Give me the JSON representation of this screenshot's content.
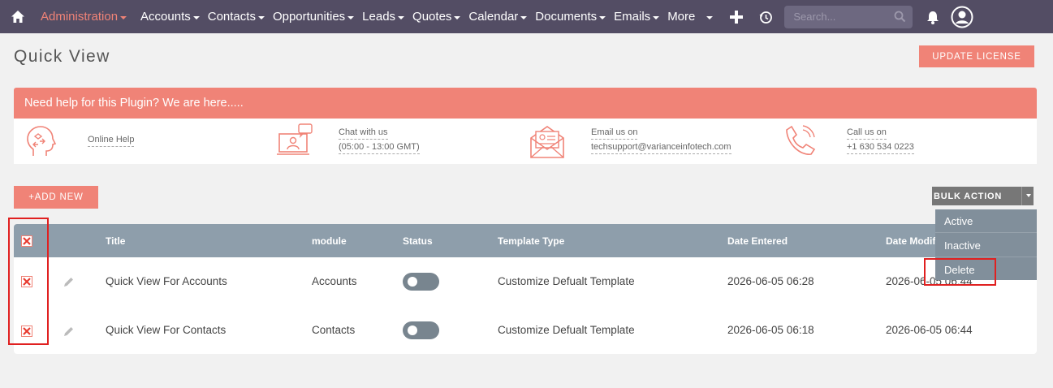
{
  "nav": {
    "items": [
      {
        "label": "Administration",
        "active": true
      },
      {
        "label": "Accounts"
      },
      {
        "label": "Contacts"
      },
      {
        "label": "Opportunities"
      },
      {
        "label": "Leads"
      },
      {
        "label": "Quotes"
      },
      {
        "label": "Calendar"
      },
      {
        "label": "Documents"
      },
      {
        "label": "Emails"
      }
    ],
    "more_label": "More",
    "search_placeholder": "Search..."
  },
  "page": {
    "title": "Quick View",
    "update_license_label": "UPDATE LICENSE"
  },
  "help": {
    "banner_text": "Need help for this Plugin? We are here.....",
    "online_help": "Online Help",
    "chat_line1": "Chat with us",
    "chat_line2": "(05:00 - 13:00 GMT)",
    "email_line1": "Email us on",
    "email_line2": "techsupport@varianceinfotech.com",
    "call_line1": "Call us on",
    "call_line2": "+1 630 534 0223"
  },
  "actions": {
    "add_new_label": "+ADD NEW",
    "bulk_action_label": "BULK ACTION"
  },
  "table": {
    "columns": [
      "Title",
      "module",
      "Status",
      "Template Type",
      "Date Entered",
      "Date Modified"
    ],
    "rows": [
      {
        "title": "Quick View For Accounts",
        "module": "Accounts",
        "status_on": false,
        "template_type": "Customize Defualt Template",
        "date_entered": "2026-06-05 06:28",
        "date_modified": "2026-06-05 06:44"
      },
      {
        "title": "Quick View For Contacts",
        "module": "Contacts",
        "status_on": false,
        "template_type": "Customize Defualt Template",
        "date_entered": "2026-06-05 06:18",
        "date_modified": "2026-06-05 06:44"
      }
    ]
  },
  "bulk_menu": {
    "items": [
      "Active",
      "Inactive",
      "Delete"
    ]
  },
  "colors": {
    "nav_bg": "#534d64",
    "accent": "#f08377",
    "table_header": "#8e9eab",
    "highlight": "#e02020"
  }
}
